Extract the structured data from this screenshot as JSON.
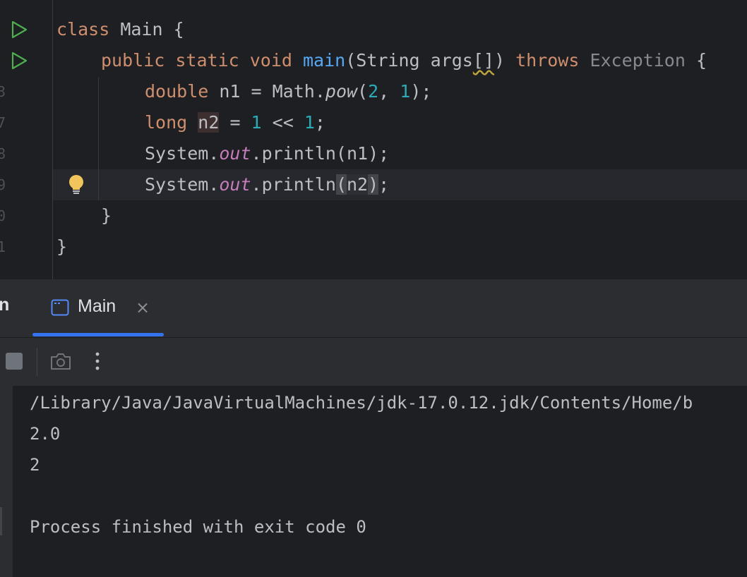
{
  "editor": {
    "line_numbers": [
      "",
      "",
      "3",
      "7",
      "8",
      "9",
      "0",
      "1"
    ],
    "lines": {
      "l1": {
        "kw": "class",
        "text": " Main {"
      },
      "l2": {
        "kw1": "public static void",
        "fn": "main",
        "t1": "(String args",
        "brackets": "[]",
        "t2": ")",
        "kw2": "throws",
        "exc": "Exception",
        "t3": " {"
      },
      "l3": {
        "kw": "double",
        "t1": " n1 = Math.",
        "method": "pow",
        "t2": "(",
        "n1": "2",
        "t3": ", ",
        "n2": "1",
        "t4": ");"
      },
      "l4": {
        "kw": "long",
        "var": "n2",
        "t1": " = ",
        "n1": "1",
        "t2": " << ",
        "n2": "1",
        "t3": ";"
      },
      "l5": {
        "t1": "System.",
        "field": "out",
        "t2": ".println(n1);"
      },
      "l6": {
        "t1": "System.",
        "field": "out",
        "t2": ".println",
        "open": "(",
        "arg": "n2",
        "close": ")",
        "t3": ";"
      },
      "l7": {
        "text": "}"
      },
      "l8": {
        "text": "}"
      }
    }
  },
  "run_panel": {
    "partial_tab": "n",
    "tab_label": "Main",
    "tab_close": "×"
  },
  "console": {
    "lines": [
      "/Library/Java/JavaVirtualMachines/jdk-17.0.12.jdk/Contents/Home/b",
      "2.0",
      "2",
      "",
      "Process finished with exit code 0"
    ]
  },
  "colors": {
    "keyword": "#cf8e6d",
    "function": "#56a8f5",
    "number": "#2aacb8",
    "field": "#c77dbb",
    "accent": "#3574f0",
    "run_icon": "#4caf50",
    "bulb": "#f2c55c"
  }
}
